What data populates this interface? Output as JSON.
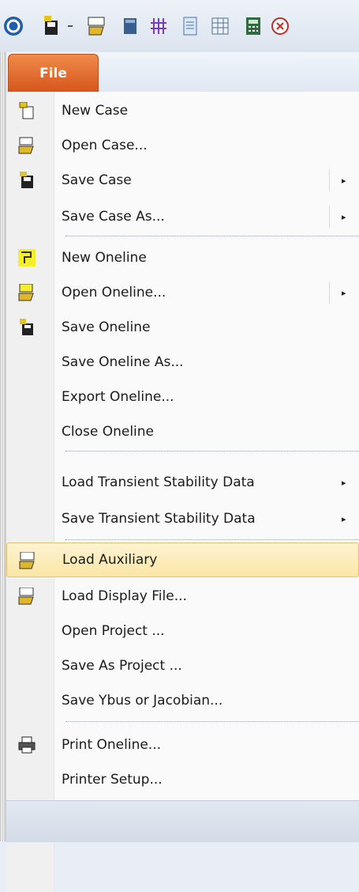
{
  "toolbar": {
    "icons": [
      "app-orb-icon",
      "save-case-icon",
      "dropdown-icon",
      "load-auxiliary-icon",
      "database-icon",
      "grid-icon",
      "document-icon",
      "table-icon",
      "calculator-icon",
      "close-icon"
    ]
  },
  "tab": {
    "label": "File"
  },
  "menu": {
    "items": [
      {
        "label": "New Case",
        "submenu": false
      },
      {
        "label": "Open Case...",
        "submenu": false
      },
      {
        "label": "Save Case",
        "submenu": true
      },
      {
        "label": "Save Case As...",
        "submenu": true
      },
      {
        "label": "New Oneline",
        "submenu": false
      },
      {
        "label": "Open Oneline...",
        "submenu": true
      },
      {
        "label": "Save Oneline",
        "submenu": false
      },
      {
        "label": "Save Oneline As...",
        "submenu": false
      },
      {
        "label": "Export Oneline...",
        "submenu": false
      },
      {
        "label": "Close Oneline",
        "submenu": false
      },
      {
        "label": "Load Transient Stability Data",
        "submenu": true
      },
      {
        "label": "Save Transient Stability Data",
        "submenu": true
      },
      {
        "label": "Load Auxiliary",
        "submenu": false,
        "highlighted": true
      },
      {
        "label": "Load Display File...",
        "submenu": false
      },
      {
        "label": "Open Project ...",
        "submenu": false
      },
      {
        "label": "Save As Project ...",
        "submenu": false
      },
      {
        "label": "Save Ybus or Jacobian...",
        "submenu": false
      },
      {
        "label": "Print Oneline...",
        "submenu": false
      },
      {
        "label": "Printer Setup...",
        "submenu": false
      }
    ],
    "submenu_arrow": "▸"
  },
  "colors": {
    "file_tab": "#e06a2c",
    "highlight": "#fbe6a6",
    "menu_bg": "#fafafa"
  }
}
